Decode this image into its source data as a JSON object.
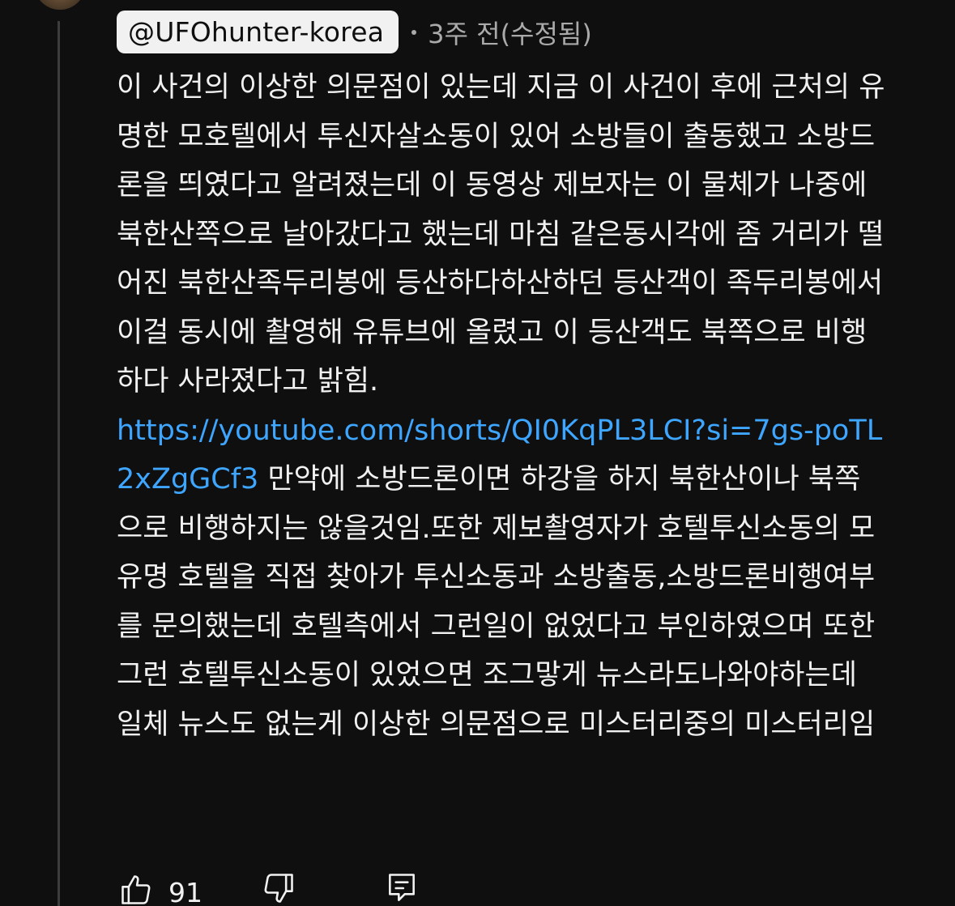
{
  "comment": {
    "author_handle": "@UFOhunter-korea",
    "time": "3주 전(수정됨)",
    "text_before_link": "이 사건의 이상한 의문점이 있는데 지금 이 사건이 후에 근처의 유명한 모호텔에서 투신자살소동이 있어 소방들이 출동했고 소방드론을 띄였다고 알려졌는데 이 동영상 제보자는 이 물체가 나중에 북한산쪽으로 날아갔다고 했는데 마침 같은동시각에 좀 거리가 떨어진 북한산족두리봉에 등산하다하산하던 등산객이 족두리봉에서 이걸 동시에 촬영해 유튜브에 올렸고 이 등산객도 북쪽으로 비행하다 사라졌다고 밝힘.",
    "link_text": "https://youtube.com/shorts/QI0KqPL3LCI?si=7gs-poTL2xZgGCf3",
    "text_after_link": " 만약에 소방드론이면  하강을 하지 북한산이나 북쪽으로 비행하지는 않을것임.또한 제보촬영자가 호텔투신소동의 모유명 호텔을 직접 찾아가 투신소동과 소방출동,소방드론비행여부를 문의했는데 호텔측에서 그런일이 없었다고 부인하였으며 또한 그런 호텔투신소동이 있었으면 조그맣게 뉴스라도나와야하는데 일체 뉴스도 없는게 이상한 의문점으로 미스터리중의 미스터리임"
  },
  "actions": {
    "like_count": "91",
    "like_icon": "thumbs-up-icon",
    "dislike_icon": "thumbs-down-icon",
    "reply_icon": "reply-comment-icon"
  },
  "colors": {
    "background": "#0f0f0f",
    "text": "#f1f1f1",
    "secondary_text": "#aaaaaa",
    "link": "#3ea6ff",
    "handle_chip_bg": "#f1f1f1"
  }
}
